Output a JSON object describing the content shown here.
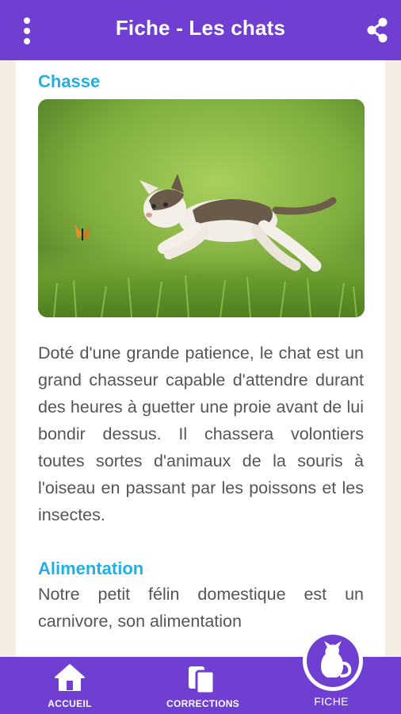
{
  "appbar": {
    "title": "Fiche - Les chats",
    "menu_icon": "more-vert-icon",
    "share_icon": "share-icon"
  },
  "sections": [
    {
      "title": "Chasse",
      "image": "kitten-chasing-butterfly-photo",
      "text": "Doté d'une grande patience, le chat est un grand chasseur capable d'attendre durant des heures à guetter une proie avant de lui bondir dessus. Il chassera volontiers toutes sortes d'animaux de la souris à l'oiseau en passant par les poissons et les insectes."
    },
    {
      "title": "Alimentation",
      "text": "Notre petit félin domestique est un carnivore, son alimentation"
    }
  ],
  "bottom_nav": {
    "items": [
      {
        "label": "ACCUEIL",
        "icon": "home-icon"
      },
      {
        "label": "CORRECTIONS",
        "icon": "documents-icon"
      },
      {
        "label": "FICHE",
        "icon": "cat-icon"
      }
    ]
  },
  "colors": {
    "primary": "#6f3fd1",
    "section_title": "#1fb1e6",
    "body_text": "#555555",
    "page_background": "#f5ede3"
  }
}
